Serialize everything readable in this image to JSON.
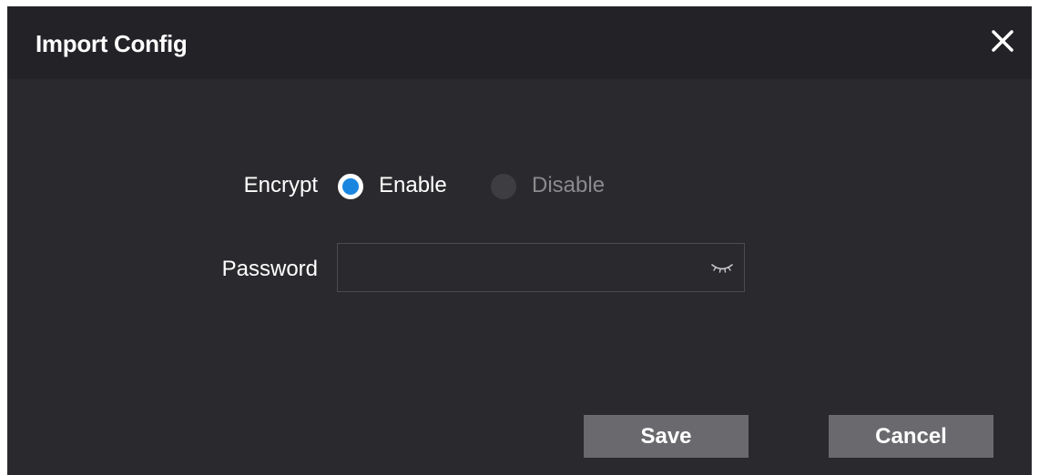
{
  "dialog": {
    "title": "Import Config",
    "close_icon": "close-icon"
  },
  "encrypt": {
    "label": "Encrypt",
    "options": [
      {
        "label": "Enable",
        "selected": true
      },
      {
        "label": "Disable",
        "selected": false
      }
    ]
  },
  "password": {
    "label": "Password",
    "value": "",
    "icon": "eye-closed-icon"
  },
  "buttons": {
    "save_label": "Save",
    "cancel_label": "Cancel"
  },
  "colors": {
    "background": "#2a2a2e",
    "titlebar": "#232327",
    "accent": "#1a86e0",
    "button": "#6a6a6e"
  }
}
